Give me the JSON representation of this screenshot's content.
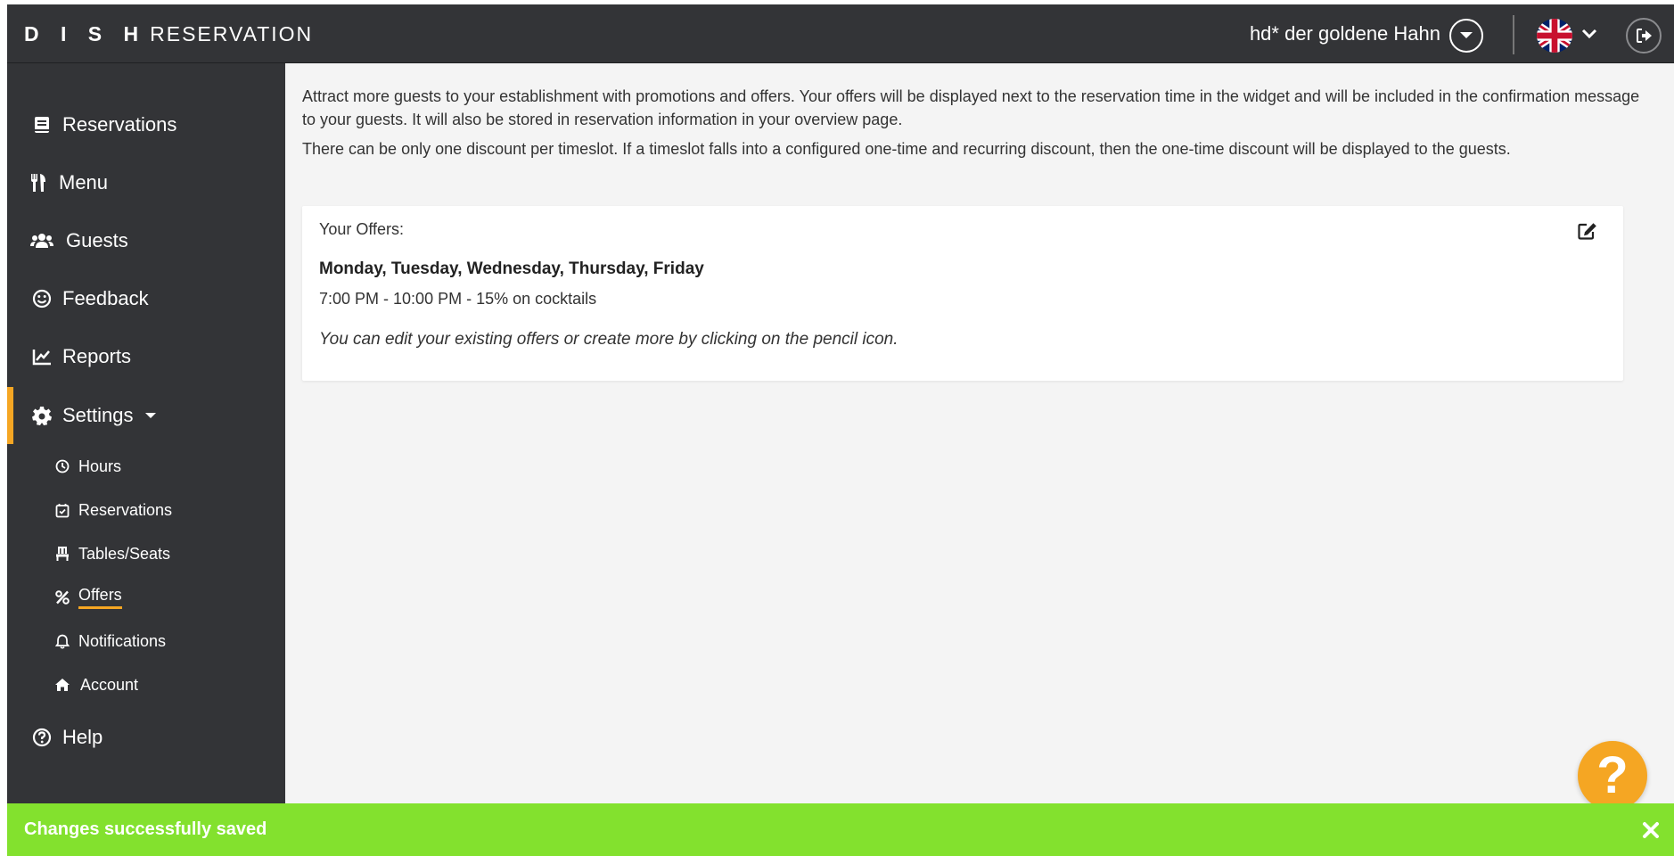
{
  "header": {
    "logo_bold": "D I S H",
    "logo_light": "RESERVATION",
    "venue_name": "hd* der goldene Hahn",
    "icons": {
      "venue_dropdown": "chevron-down-circle-icon",
      "language": "uk-flag-icon",
      "language_dropdown": "chevron-down-icon",
      "logout": "logout-icon"
    }
  },
  "sidebar": {
    "items": [
      {
        "label": "Reservations",
        "icon": "book-icon"
      },
      {
        "label": "Menu",
        "icon": "utensils-icon"
      },
      {
        "label": "Guests",
        "icon": "users-icon"
      },
      {
        "label": "Feedback",
        "icon": "smile-icon"
      },
      {
        "label": "Reports",
        "icon": "chart-line-icon"
      },
      {
        "label": "Settings",
        "icon": "gear-icon",
        "active": true
      }
    ],
    "sub_items": [
      {
        "label": "Hours",
        "icon": "clock-icon"
      },
      {
        "label": "Reservations",
        "icon": "calendar-check-icon"
      },
      {
        "label": "Tables/Seats",
        "icon": "chair-icon"
      },
      {
        "label": "Offers",
        "icon": "percent-icon",
        "active": true
      },
      {
        "label": "Notifications",
        "icon": "bell-icon"
      },
      {
        "label": "Account",
        "icon": "home-icon"
      }
    ],
    "help": {
      "label": "Help",
      "icon": "question-circle-icon"
    }
  },
  "main": {
    "intro_1": "Attract more guests to your establishment with promotions and offers. Your offers will be displayed next to the reservation time in the widget and will be included in the confirmation message to your guests. It will also be stored in reservation information in your overview page.",
    "intro_2": "There can be only one discount per timeslot. If a timeslot falls into a configured one-time and recurring discount, then the one-time discount will be displayed to the guests.",
    "offers_card": {
      "heading": "Your Offers:",
      "days": "Monday, Tuesday, Wednesday, Thursday, Friday",
      "offer": "7:00 PM - 10:00 PM - 15% on cocktails",
      "hint": "You can edit your existing offers or create more by clicking on the pencil icon."
    }
  },
  "help_fab": {
    "label": "?"
  },
  "toast": {
    "message": "Changes successfully saved",
    "close_icon": "close-icon"
  },
  "colors": {
    "sidebar_bg": "#333437",
    "accent": "#f5a623",
    "toast_bg": "#83e12e",
    "content_bg": "#f4f4f4"
  }
}
